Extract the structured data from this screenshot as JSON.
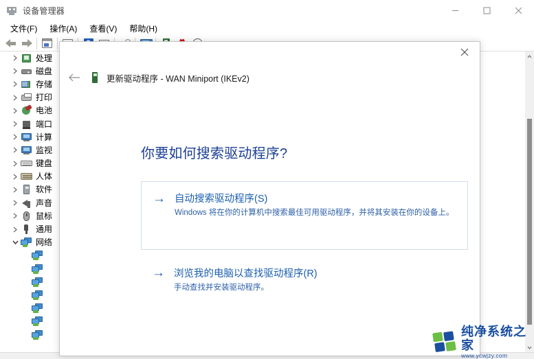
{
  "window": {
    "title": "设备管理器",
    "icon": "device-manager-icon",
    "controls": {
      "minimize": "minimize-icon",
      "maximize": "maximize-icon",
      "close": "close-icon"
    }
  },
  "menubar": {
    "items": [
      {
        "label": "文件(F)",
        "name": "menu-file"
      },
      {
        "label": "操作(A)",
        "name": "menu-action"
      },
      {
        "label": "查看(V)",
        "name": "menu-view"
      },
      {
        "label": "帮助(H)",
        "name": "menu-help"
      }
    ]
  },
  "toolbar": {
    "buttons": [
      {
        "name": "back-button",
        "icon": "back-arrow-icon"
      },
      {
        "name": "forward-button",
        "icon": "forward-arrow-icon"
      },
      {
        "name": "properties-button",
        "icon": "properties-icon"
      },
      {
        "name": "update-driver-button",
        "icon": "update-driver-icon"
      },
      {
        "name": "help-button",
        "icon": "help-icon"
      },
      {
        "name": "show-hidden-button",
        "icon": "list-icon"
      },
      {
        "name": "scan-hardware-button",
        "icon": "scan-icon"
      },
      {
        "name": "view-devices-button",
        "icon": "monitor-icon"
      },
      {
        "name": "enable-device-button",
        "icon": "device-icon"
      },
      {
        "name": "uninstall-device-button",
        "icon": "red-x-icon"
      },
      {
        "name": "add-legacy-hardware-button",
        "icon": "install-icon"
      }
    ]
  },
  "tree": {
    "nodes": [
      {
        "label": "处理",
        "icon": "cpu-icon",
        "expanded": false,
        "truncated": true
      },
      {
        "label": "磁盘",
        "icon": "disk-drive-icon",
        "expanded": false,
        "truncated": true
      },
      {
        "label": "存储",
        "icon": "storage-controller-icon",
        "expanded": false,
        "truncated": true
      },
      {
        "label": "打印",
        "icon": "print-queue-icon",
        "expanded": false,
        "truncated": true
      },
      {
        "label": "电池",
        "icon": "battery-icon",
        "expanded": false,
        "truncated": true
      },
      {
        "label": "端口",
        "icon": "port-icon",
        "expanded": false,
        "truncated": true
      },
      {
        "label": "计算",
        "icon": "computer-icon",
        "expanded": false,
        "truncated": true
      },
      {
        "label": "监视",
        "icon": "monitor-icon",
        "expanded": false,
        "truncated": true
      },
      {
        "label": "键盘",
        "icon": "keyboard-icon",
        "expanded": false,
        "truncated": true
      },
      {
        "label": "人体",
        "icon": "hid-icon",
        "expanded": false,
        "truncated": true
      },
      {
        "label": "软件",
        "icon": "software-device-icon",
        "expanded": false,
        "truncated": true
      },
      {
        "label": "声音",
        "icon": "sound-icon",
        "expanded": false,
        "truncated": true
      },
      {
        "label": "鼠标",
        "icon": "mouse-icon",
        "expanded": false,
        "truncated": true
      },
      {
        "label": "通用",
        "icon": "usb-icon",
        "expanded": false,
        "truncated": true
      },
      {
        "label": "网络",
        "icon": "network-adapter-icon",
        "expanded": true,
        "truncated": true
      }
    ],
    "children": [
      {
        "label": "",
        "icon": "network-adapter-icon"
      },
      {
        "label": "",
        "icon": "network-adapter-icon"
      },
      {
        "label": "",
        "icon": "network-adapter-icon"
      },
      {
        "label": "",
        "icon": "network-adapter-icon"
      },
      {
        "label": "",
        "icon": "network-adapter-icon"
      },
      {
        "label": "",
        "icon": "network-adapter-icon"
      },
      {
        "label": "",
        "icon": "network-adapter-icon"
      }
    ]
  },
  "dialog": {
    "close_icon": "close-icon",
    "back_icon": "back-arrow-icon",
    "header_icon": "device-icon",
    "header_title": "更新驱动程序 - WAN Miniport (IKEv2)",
    "question": "你要如何搜索驱动程序?",
    "options": [
      {
        "name": "auto-search-driver-option",
        "arrow": "→",
        "title": "自动搜索驱动程序(S)",
        "desc": "Windows 将在你的计算机中搜索最佳可用驱动程序，并将其安装在你的设备上。"
      },
      {
        "name": "browse-computer-driver-option",
        "arrow": "→",
        "title": "浏览我的电脑以查找驱动程序(R)",
        "desc": "手动查找并安装驱动程序。"
      }
    ]
  },
  "watermark": {
    "name": "纯净系统之家",
    "url": "www.ycwjzy.com"
  },
  "colors": {
    "heading_blue": "#1b3f94",
    "link_blue": "#1b5fb0",
    "desc_blue": "#2d5fa8",
    "option_border": "#cfdced",
    "brand_blue": "#1b4fa0",
    "brand_green": "#6cbe45",
    "close_hover_red": "#e81123"
  }
}
